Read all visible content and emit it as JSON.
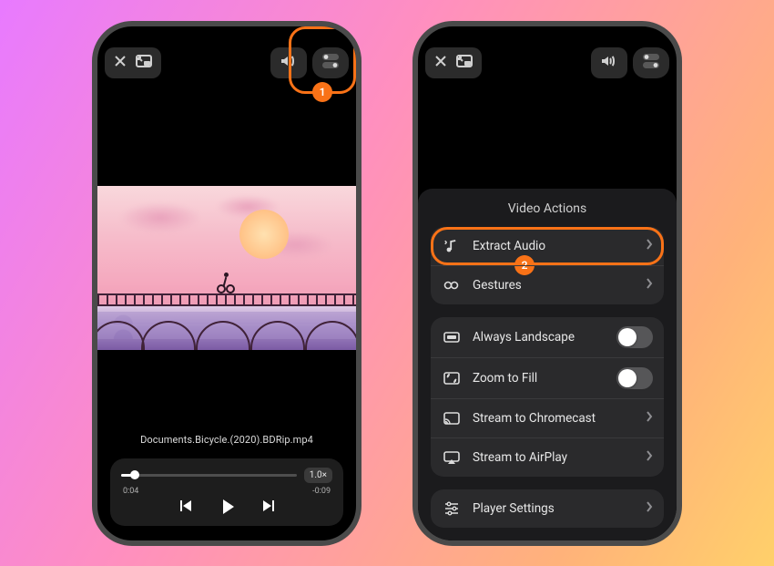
{
  "callouts": {
    "one": "1",
    "two": "2"
  },
  "player": {
    "filename": "Documents.Bicycle.(2020).BDRip.mp4",
    "elapsed": "0:04",
    "remaining": "-0:09",
    "speed": "1.0×"
  },
  "sheet": {
    "title": "Video Actions",
    "extract": "Extract Audio",
    "gestures": "Gestures",
    "landscape": "Always Landscape",
    "zoom": "Zoom to Fill",
    "chromecast": "Stream to Chromecast",
    "airplay": "Stream to AirPlay",
    "settings": "Player Settings"
  }
}
